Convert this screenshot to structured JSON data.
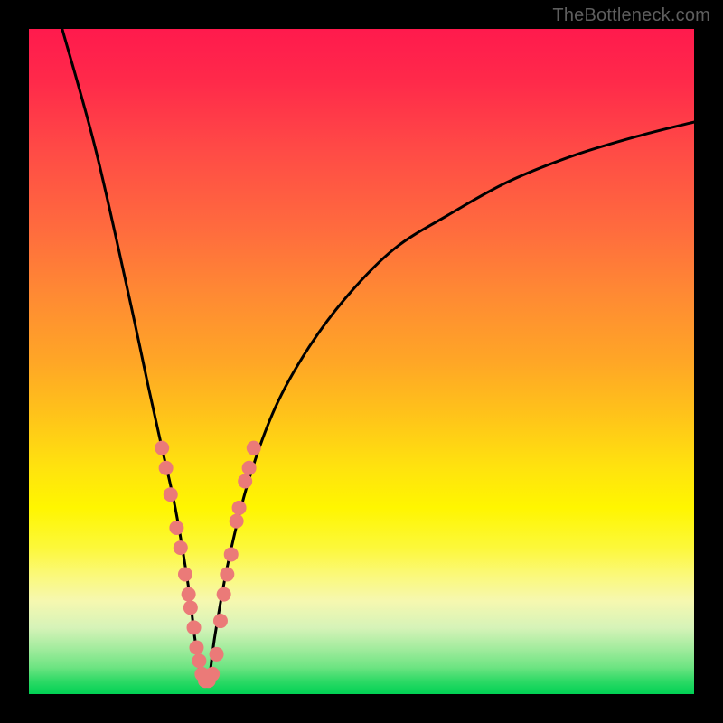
{
  "watermark": "TheBottleneck.com",
  "colors": {
    "frame": "#000000",
    "curve": "#000000",
    "marker": "#eb7a78",
    "gradient_top": "#ff1a4d",
    "gradient_bottom": "#00d154"
  },
  "chart_data": {
    "type": "line",
    "title": "",
    "xlabel": "",
    "ylabel": "",
    "xlim": [
      0,
      100
    ],
    "ylim": [
      0,
      100
    ],
    "grid": false,
    "legend": false,
    "description": "V-shaped bottleneck curve over a red→green vertical gradient background. Minimum (bottom of V) around x≈26. Pink/salmon dotted markers along the lower portions of both arms of the V.",
    "series": [
      {
        "name": "bottleneck-curve",
        "x": [
          5,
          10,
          15,
          18,
          20,
          22,
          24,
          25,
          26,
          27,
          28,
          30,
          33,
          37,
          42,
          48,
          55,
          63,
          72,
          82,
          92,
          100
        ],
        "y": [
          100,
          82,
          60,
          46,
          37,
          28,
          16,
          8,
          2,
          2,
          9,
          20,
          32,
          43,
          52,
          60,
          67,
          72,
          77,
          81,
          84,
          86
        ]
      }
    ],
    "markers": [
      {
        "x": 20.0,
        "y": 37
      },
      {
        "x": 20.6,
        "y": 34
      },
      {
        "x": 21.3,
        "y": 30
      },
      {
        "x": 22.2,
        "y": 25
      },
      {
        "x": 22.8,
        "y": 22
      },
      {
        "x": 23.5,
        "y": 18
      },
      {
        "x": 24.0,
        "y": 15
      },
      {
        "x": 24.3,
        "y": 13
      },
      {
        "x": 24.8,
        "y": 10
      },
      {
        "x": 25.2,
        "y": 7
      },
      {
        "x": 25.6,
        "y": 5
      },
      {
        "x": 26.0,
        "y": 3
      },
      {
        "x": 26.5,
        "y": 2
      },
      {
        "x": 27.0,
        "y": 2
      },
      {
        "x": 27.6,
        "y": 3
      },
      {
        "x": 28.2,
        "y": 6
      },
      {
        "x": 28.8,
        "y": 11
      },
      {
        "x": 29.3,
        "y": 15
      },
      {
        "x": 29.8,
        "y": 18
      },
      {
        "x": 30.4,
        "y": 21
      },
      {
        "x": 31.2,
        "y": 26
      },
      {
        "x": 31.6,
        "y": 28
      },
      {
        "x": 32.5,
        "y": 32
      },
      {
        "x": 33.1,
        "y": 34
      },
      {
        "x": 33.8,
        "y": 37
      }
    ]
  }
}
